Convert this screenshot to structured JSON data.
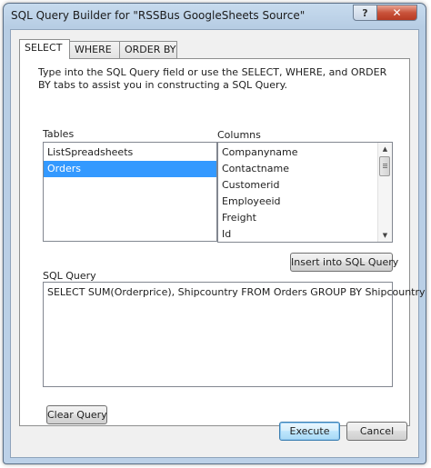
{
  "window": {
    "title": "SQL Query Builder for \"RSSBus GoogleSheets Source\"",
    "help_label": "?",
    "close_label": "✕"
  },
  "tabs": [
    {
      "label": "SELECT",
      "active": true
    },
    {
      "label": "WHERE",
      "active": false
    },
    {
      "label": "ORDER BY",
      "active": false
    }
  ],
  "select_tab": {
    "description": "Type into the SQL Query field or use the SELECT, WHERE, and ORDER BY tabs to assist you in constructing a SQL Query.",
    "tables_label": "Tables",
    "tables": [
      {
        "name": "ListSpreadsheets",
        "selected": false
      },
      {
        "name": "Orders",
        "selected": true
      }
    ],
    "columns_label": "Columns",
    "columns": [
      "Companyname",
      "Contactname",
      "Customerid",
      "Employeeid",
      "Freight",
      "Id"
    ],
    "insert_button_label": "Insert into SQL Query",
    "sql_query_label": "SQL Query",
    "sql_query_value": "SELECT SUM(Orderprice), Shipcountry FROM Orders GROUP BY Shipcountry",
    "clear_button_label": "Clear Query"
  },
  "footer": {
    "execute_label": "Execute",
    "cancel_label": "Cancel"
  },
  "colors": {
    "selection": "#3399ff",
    "close_button": "#c9533a",
    "frame": "#bcd1e8"
  }
}
